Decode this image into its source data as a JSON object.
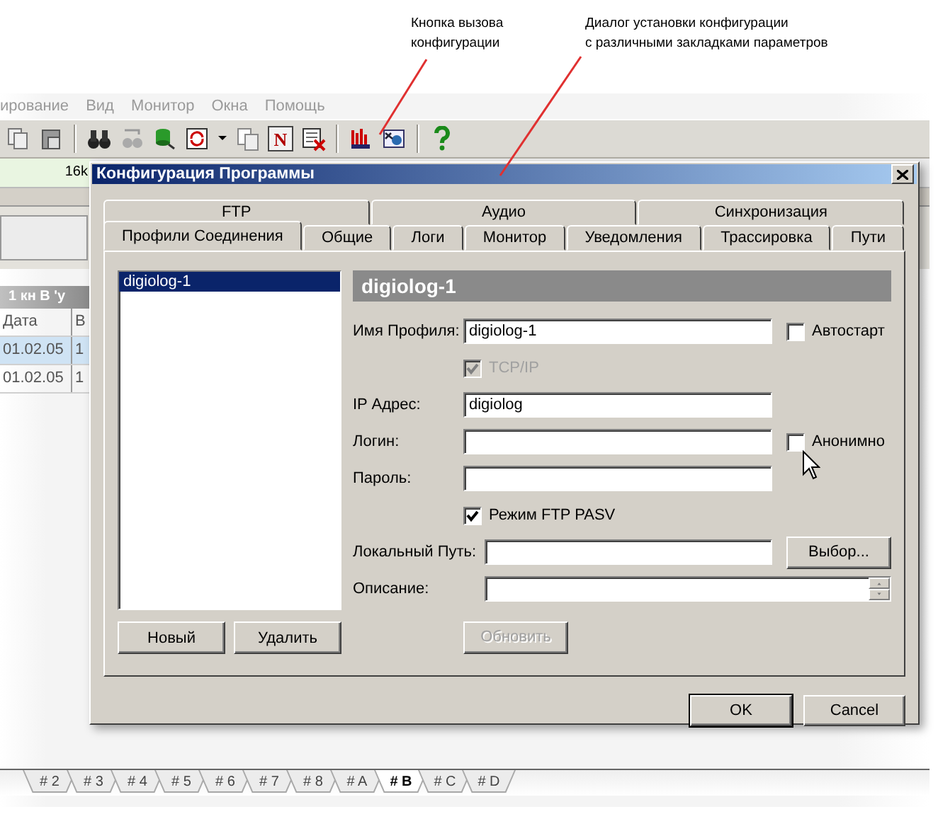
{
  "annotations": [
    {
      "text": "Кнопка вызова\nконфигурации"
    },
    {
      "text": "Диалог установки конфигурации\nс различными закладками параметров"
    }
  ],
  "menu": [
    "ирование",
    "Вид",
    "Монитор",
    "Окна",
    "Помощь"
  ],
  "toolbar_letter": "N",
  "background": {
    "field_text": "16k",
    "list_title": "1  кн В 'у",
    "columns": [
      "Дата",
      "В"
    ],
    "rows": [
      {
        "cells": [
          "01.02.05",
          "1"
        ],
        "selected": true
      },
      {
        "cells": [
          "01.02.05",
          "1"
        ],
        "selected": false
      }
    ]
  },
  "dialog": {
    "title": "Конфигурация Программы",
    "tab_rows": [
      [
        {
          "label": "FTP",
          "selected": false
        },
        {
          "label": "Аудио",
          "selected": false
        },
        {
          "label": "Синхронизация",
          "selected": false
        }
      ],
      [
        {
          "label": "Профили Соединения",
          "selected": true
        },
        {
          "label": "Общие",
          "selected": false
        },
        {
          "label": "Логи",
          "selected": false
        },
        {
          "label": "Монитор",
          "selected": false
        },
        {
          "label": "Уведомления",
          "selected": false
        },
        {
          "label": "Трассировка",
          "selected": false
        },
        {
          "label": "Пути",
          "selected": false
        }
      ]
    ],
    "profiles": [
      {
        "label": "digiolog-1",
        "selected": true
      }
    ],
    "profile_buttons": [
      "Новый",
      "Удалить"
    ],
    "header": "digiolog-1",
    "fields": [
      {
        "kind": "input",
        "label": "Имя Профиля:",
        "value": "digiolog-1",
        "check": {
          "label": "Автостарт",
          "checked": false
        }
      },
      {
        "kind": "checkbox",
        "label": "TCP/IP",
        "checked": true,
        "disabled": true
      },
      {
        "kind": "input",
        "label": "IP Адрес:",
        "value": "digiolog"
      },
      {
        "kind": "input",
        "label": "Логин:",
        "check": {
          "label": "Анонимно",
          "checked": false
        }
      },
      {
        "kind": "input",
        "label": "Пароль:"
      },
      {
        "kind": "checkbox",
        "label": "Режим FTP PASV",
        "checked": true,
        "disabled": false
      },
      {
        "kind": "input",
        "label": "Локальный Путь:",
        "button": "Выбор..."
      },
      {
        "kind": "spin",
        "label": "Описание:"
      },
      {
        "kind": "button",
        "label": "Обновить",
        "disabled": true
      }
    ],
    "buttons": [
      "OK",
      "Cancel"
    ]
  },
  "sheet_tabs": [
    {
      "label": "# 2",
      "selected": false
    },
    {
      "label": "# 3",
      "selected": false
    },
    {
      "label": "# 4",
      "selected": false
    },
    {
      "label": "# 5",
      "selected": false
    },
    {
      "label": "# 6",
      "selected": false
    },
    {
      "label": "# 7",
      "selected": false
    },
    {
      "label": "# 8",
      "selected": false
    },
    {
      "label": "# A",
      "selected": false
    },
    {
      "label": "# B",
      "selected": true
    },
    {
      "label": "# C",
      "selected": false
    },
    {
      "label": "# D",
      "selected": false
    }
  ]
}
